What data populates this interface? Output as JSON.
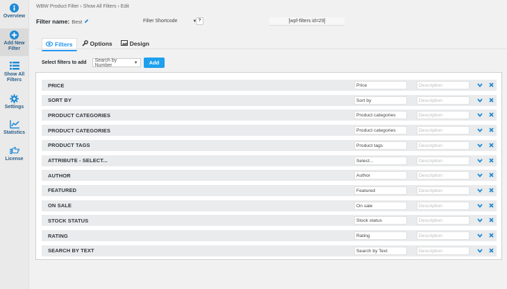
{
  "sidebar": {
    "items": [
      {
        "label": "Overview",
        "icon": "info-icon"
      },
      {
        "label": "Add New Filter",
        "icon": "plus-circle-icon"
      },
      {
        "label": "Show All Filters",
        "icon": "list-icon"
      },
      {
        "label": "Settings",
        "icon": "gear-icon"
      },
      {
        "label": "Statistics",
        "icon": "chart-line-icon"
      },
      {
        "label": "License",
        "icon": "hand-point-icon"
      }
    ]
  },
  "breadcrumb": "WBW Product Filter  ›  Show All Filters  ›  Edit",
  "filter_name": {
    "label": "Filter name:",
    "value": "Best"
  },
  "shortcode": {
    "selector_label": "Filter Shortcode",
    "help": "?",
    "value": "[wpf-filters id=29]"
  },
  "tabs": [
    {
      "label": "Filters",
      "icon": "eye-icon"
    },
    {
      "label": "Options",
      "icon": "wrench-icon"
    },
    {
      "label": "Design",
      "icon": "image-icon"
    }
  ],
  "add_filter": {
    "label": "Select filters to add",
    "select_value": "Search by Number",
    "button": "Add"
  },
  "filters": [
    {
      "name": "PRICE",
      "title": "Price",
      "description_placeholder": "Description"
    },
    {
      "name": "SORT BY",
      "title": "Sort by",
      "description_placeholder": "Description"
    },
    {
      "name": "PRODUCT CATEGORIES",
      "title": "Product categories",
      "description_placeholder": "Description"
    },
    {
      "name": "PRODUCT CATEGORIES",
      "title": "Product categories",
      "description_placeholder": "Description"
    },
    {
      "name": "PRODUCT TAGS",
      "title": "Product tags",
      "description_placeholder": "Description"
    },
    {
      "name": "ATTRIBUTE - SELECT...",
      "title": "Select...",
      "description_placeholder": "Description"
    },
    {
      "name": "AUTHOR",
      "title": "Author",
      "description_placeholder": "Description"
    },
    {
      "name": "FEATURED",
      "title": "Featured",
      "description_placeholder": "Description"
    },
    {
      "name": "ON SALE",
      "title": "On sale",
      "description_placeholder": "Description"
    },
    {
      "name": "STOCK STATUS",
      "title": "Stock status",
      "description_placeholder": "Description"
    },
    {
      "name": "RATING",
      "title": "Rating",
      "description_placeholder": "Description"
    },
    {
      "name": "SEARCH BY TEXT",
      "title": "Search by Text",
      "description_placeholder": "Description"
    }
  ],
  "colors": {
    "accent": "#1ea0ed",
    "nav_label": "#2b5e86",
    "row_bg": "#e9ebed"
  }
}
